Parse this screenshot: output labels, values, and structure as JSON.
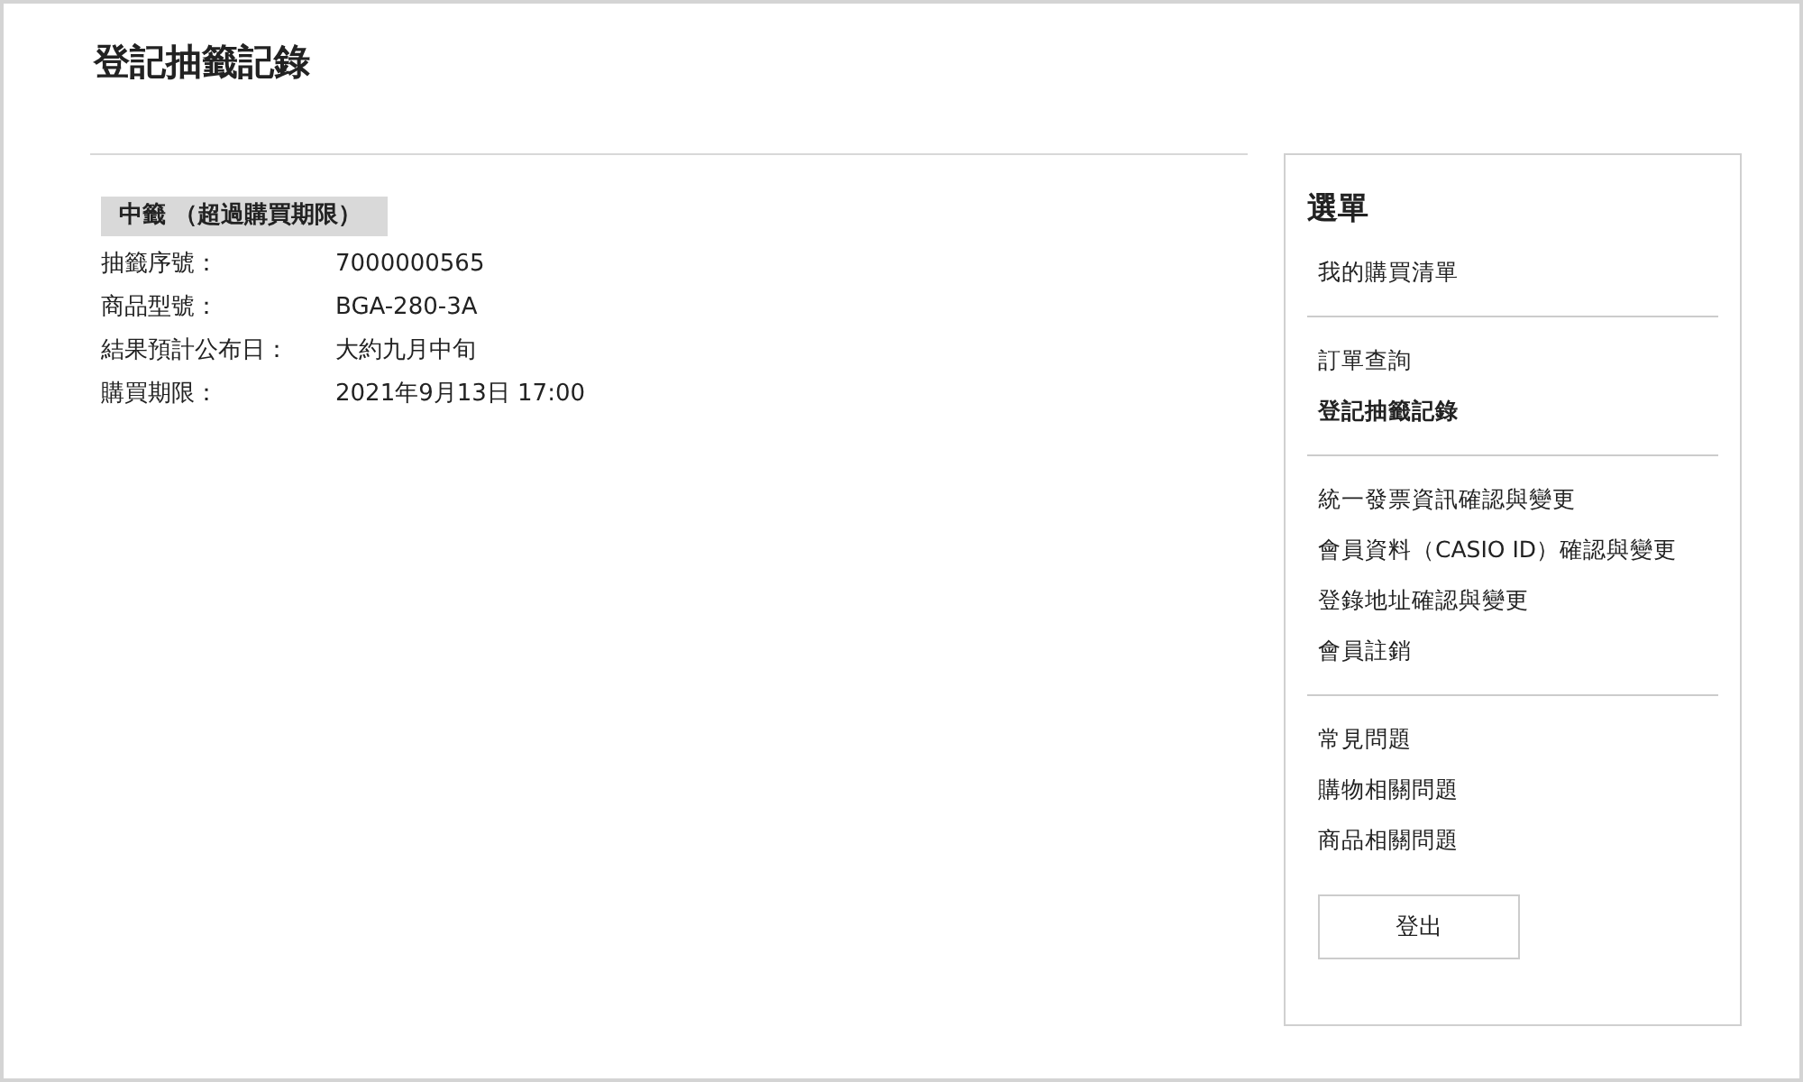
{
  "page_title": "登記抽籤記錄",
  "entry": {
    "status": "中籤 （超過購買期限）",
    "fields": [
      {
        "label": "抽籤序號：",
        "value": "7000000565"
      },
      {
        "label": "商品型號：",
        "value": "BGA-280-3A"
      },
      {
        "label": "結果預計公布日：",
        "value": "大約九月中旬"
      },
      {
        "label": "購買期限：",
        "value": "2021年9月13日 17:00"
      }
    ]
  },
  "menu": {
    "title": "選單",
    "groups": [
      [
        {
          "label": "我的購買清單",
          "selected": false
        }
      ],
      [
        {
          "label": "訂單查詢",
          "selected": false
        },
        {
          "label": "登記抽籤記錄",
          "selected": true
        }
      ],
      [
        {
          "label": "統一發票資訊確認與變更",
          "selected": false
        },
        {
          "label": "會員資料（CASIO ID）確認與變更",
          "selected": false
        },
        {
          "label": "登錄地址確認與變更",
          "selected": false
        },
        {
          "label": "會員註銷",
          "selected": false
        }
      ],
      [
        {
          "label": "常見問題",
          "selected": false
        },
        {
          "label": "購物相關問題",
          "selected": false
        },
        {
          "label": "商品相關問題",
          "selected": false
        }
      ]
    ],
    "logout": "登出"
  }
}
